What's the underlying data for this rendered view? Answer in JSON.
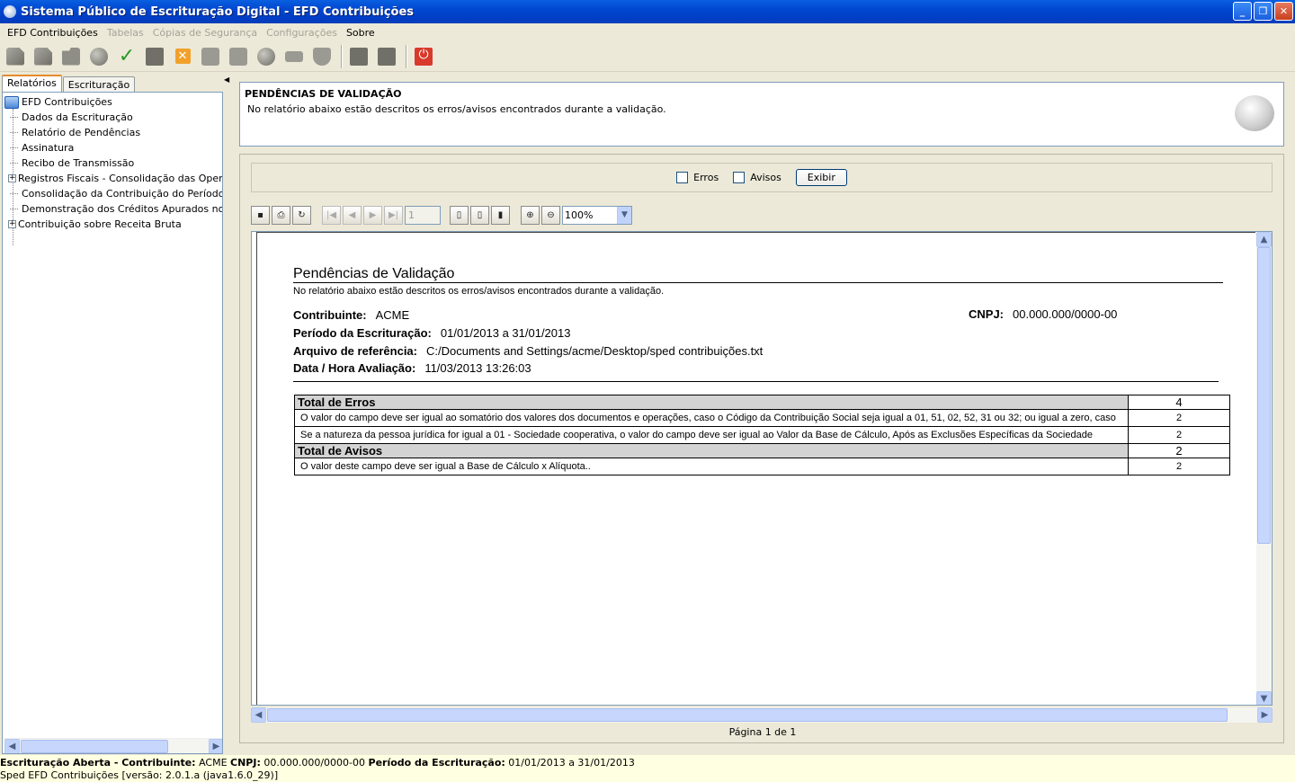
{
  "window": {
    "title": "Sistema Público de Escrituração Digital - EFD Contribuições",
    "minimize": "_",
    "restore": "❐",
    "close": "✕"
  },
  "menu": {
    "items": [
      {
        "label": "EFD Contribuições",
        "enabled": true
      },
      {
        "label": "Tabelas",
        "enabled": false
      },
      {
        "label": "Cópias de Segurança",
        "enabled": false
      },
      {
        "label": "Configurações",
        "enabled": false
      },
      {
        "label": "Sobre",
        "enabled": true
      }
    ]
  },
  "toolbar": {
    "icons": [
      "new-doc-icon",
      "open-doc-icon",
      "folder-icon",
      "import-gear-icon",
      "validate-check-icon",
      "copy-icon",
      "delete-icon",
      "signature-icon",
      "transmit-icon",
      "globe-icon",
      "envelope-icon",
      "shield-icon",
      "save-icon",
      "save-as-icon",
      "power-icon"
    ],
    "power_glyph": "⏻",
    "check_glyph": "✓",
    "x_glyph": "✕"
  },
  "left_panel": {
    "tabs": [
      {
        "label": "Relatórios",
        "active": true
      },
      {
        "label": "Escrituração",
        "active": false
      }
    ],
    "tree": {
      "root": "EFD Contribuições",
      "items": [
        {
          "label": "Dados da Escrituração",
          "expandable": false
        },
        {
          "label": "Relatório de Pendências",
          "expandable": false
        },
        {
          "label": "Assinatura",
          "expandable": false
        },
        {
          "label": "Recibo de Transmissão",
          "expandable": false
        },
        {
          "label": "Registros Fiscais - Consolidação das Operaçõ",
          "expandable": true
        },
        {
          "label": "Consolidação da Contribuição do Período",
          "expandable": false
        },
        {
          "label": "Demonstração dos Créditos Apurados no Perío",
          "expandable": false
        },
        {
          "label": "Contribuição sobre Receita Bruta",
          "expandable": true
        }
      ]
    }
  },
  "header": {
    "title": "PENDÊNCIAS DE VALIDAÇÃO",
    "description": "No relatório abaixo estão descritos os erros/avisos encontrados durante a validação."
  },
  "filter": {
    "erros_label": "Erros",
    "erros_checked": false,
    "avisos_label": "Avisos",
    "avisos_checked": false,
    "exibir_label": "Exibir"
  },
  "viewer": {
    "page_input": "1",
    "zoom": "100%",
    "page_label": "Página 1 de 1"
  },
  "report": {
    "title": "Pendências de Validação",
    "subtitle": "No relatório abaixo estão descritos os erros/avisos encontrados durante a validação.",
    "contribuinte_label": "Contribuinte:",
    "contribuinte": "ACME",
    "cnpj_label": "CNPJ:",
    "cnpj": "00.000.000/0000-00",
    "periodo_label": "Período da Escrituração:",
    "periodo": "01/01/2013 a 31/01/2013",
    "arquivo_label": "Arquivo de referência:",
    "arquivo": "C:/Documents and Settings/acme/Desktop/sped contribuições.txt",
    "data_label": "Data / Hora Avaliação:",
    "data": "11/03/2013 13:26:03",
    "erros_total_label": "Total de Erros",
    "erros_total": "4",
    "erros": [
      {
        "text": "O valor do campo deve ser igual ao somatório dos valores dos documentos e operações, caso o Código da Contribuição Social seja igual a 01, 51, 02, 52, 31 ou 32; ou igual a zero, caso",
        "count": "2"
      },
      {
        "text": "Se a natureza da pessoa jurídica for igual a 01 - Sociedade cooperativa, o valor do campo deve ser igual ao Valor da Base de Cálculo, Após as Exclusões Específicas da Sociedade",
        "count": "2"
      }
    ],
    "avisos_total_label": "Total de Avisos",
    "avisos_total": "2",
    "avisos": [
      {
        "text": "O valor deste campo deve ser igual a Base de Cálculo x Alíquota..",
        "count": "2"
      }
    ]
  },
  "status": {
    "line1_label1": "Escrituração Aberta - Contribuinte:",
    "line1_value1": "ACME",
    "line1_label2": "CNPJ:",
    "line1_value2": "00.000.000/0000-00",
    "line1_label3": "Período da Escrituração:",
    "line1_value3": "01/01/2013 a 31/01/2013",
    "line2": "Sped EFD Contribuições [versão: 2.0.1.a (java1.6.0_29)]"
  }
}
